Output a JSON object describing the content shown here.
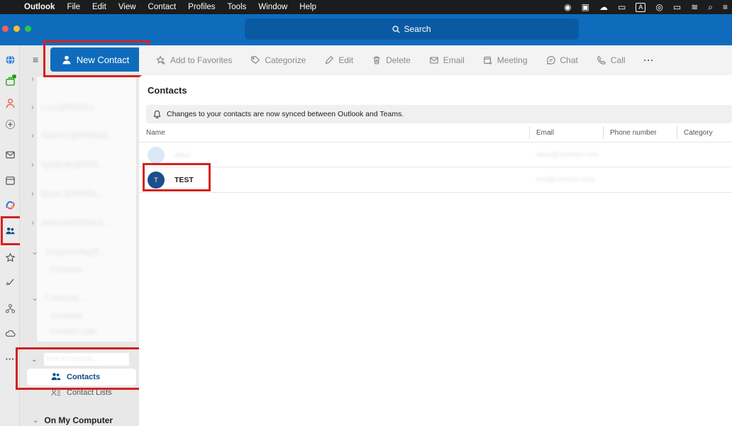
{
  "menubar": {
    "app": "Outlook",
    "items": [
      "File",
      "Edit",
      "View",
      "Contact",
      "Profiles",
      "Tools",
      "Window",
      "Help"
    ],
    "tray_box": "A"
  },
  "titlebar": {
    "search_label": "Search"
  },
  "folders": {
    "new_contact_label": "New Contact",
    "accounts": [
      "Lucy@M365x...",
      "AdeleV@M365x8...",
      "lightbulb@M36...",
      "BlueL@M365x...",
      "admin@M365x5...",
      "Engineering@...",
      "Contacts..."
    ],
    "sub_1": "Contacts",
    "sub_2": "Contacts",
    "sub_3": "Contact Lists",
    "active_account": "test-account@...",
    "nav_contacts": "Contacts",
    "nav_contact_lists": "Contact Lists",
    "on_my_computer": "On My Computer"
  },
  "toolbar": {
    "add_favorites": "Add to Favorites",
    "categorize": "Categorize",
    "edit": "Edit",
    "delete": "Delete",
    "email": "Email",
    "meeting": "Meeting",
    "chat": "Chat",
    "call": "Call",
    "more": "···"
  },
  "content": {
    "title": "Contacts",
    "banner": "Changes to your contacts are now synced between Outlook and Teams.",
    "columns": {
      "name": "Name",
      "email": "Email",
      "phone": "Phone number",
      "category": "Category"
    },
    "rows": [
      {
        "initial": "",
        "name": "Alexi",
        "email": "alexi@contoso.com",
        "avatar_color": "#dbe9f7"
      },
      {
        "initial": "T",
        "name": "TEST",
        "email": "test@contoso.com",
        "avatar_color": "#1a4f8b"
      }
    ]
  },
  "colors": {
    "accent": "#0f6cbd",
    "highlight": "#d72020"
  }
}
